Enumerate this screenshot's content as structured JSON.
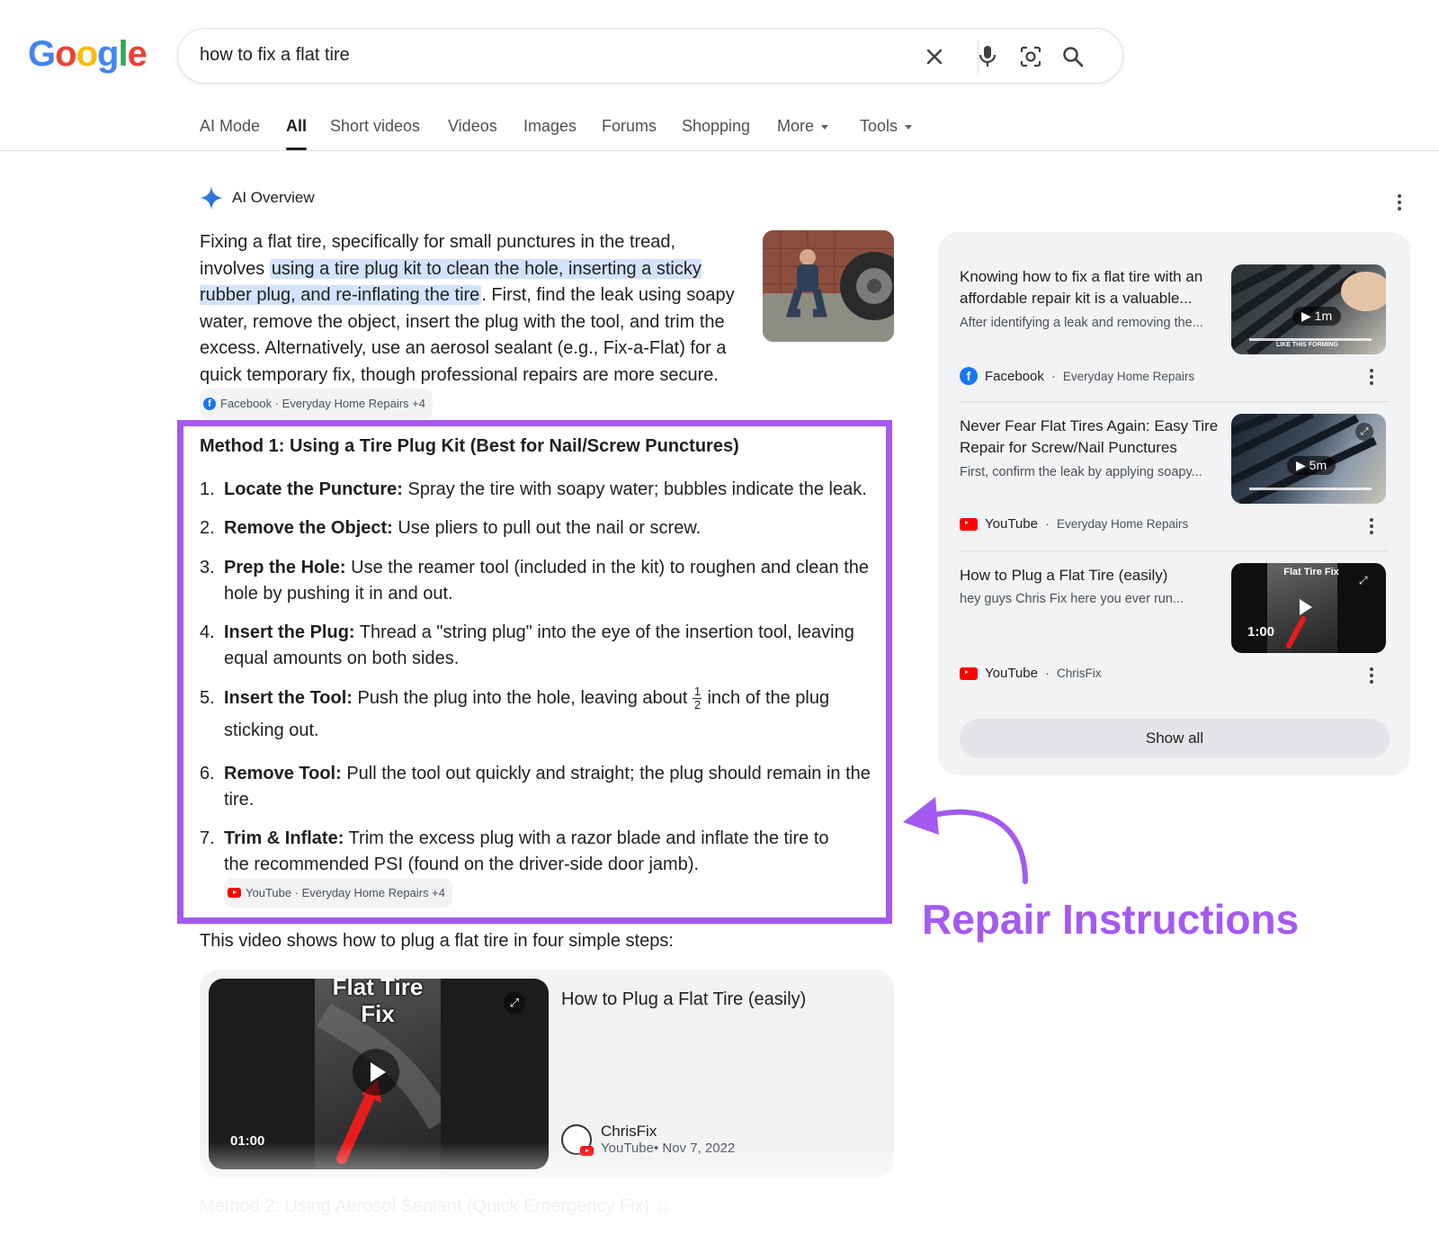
{
  "logo": "Google",
  "search": {
    "query": "how to fix a flat tire"
  },
  "tabs": [
    {
      "label": "AI Mode"
    },
    {
      "label": "All"
    },
    {
      "label": "Short videos"
    },
    {
      "label": "Videos"
    },
    {
      "label": "Images"
    },
    {
      "label": "Forums"
    },
    {
      "label": "Shopping"
    },
    {
      "label": "More"
    },
    {
      "label": "Tools"
    }
  ],
  "ai_overview": {
    "label": "AI Overview",
    "intro_before": "Fixing a flat tire, specifically for small punctures in the tread, involves ",
    "intro_highlight": "using a tire plug kit to clean the hole, inserting a sticky rubber plug, and re-inflating the tire",
    "intro_after": ". First, find the leak using soapy water, remove the object, insert the plug with the tool, and trim the excess. Alternatively, use an aerosol sealant (e.g., Fix-a-Flat) for a quick temporary fix, though professional repairs are more secure.",
    "intro_chip": "Facebook · Everyday Home Repairs +4"
  },
  "method1": {
    "title": "Method 1: Using a Tire Plug Kit (Best for Nail/Screw Punctures)",
    "steps": [
      {
        "num": "1.",
        "head": "Locate the Puncture:",
        "text": " Spray the tire with soapy water; bubbles indicate the leak."
      },
      {
        "num": "2.",
        "head": "Remove the Object:",
        "text": " Use pliers to pull out the nail or screw."
      },
      {
        "num": "3.",
        "head": "Prep the Hole:",
        "text": " Use the reamer tool (included in the kit) to roughen and clean the hole by pushing it in and out."
      },
      {
        "num": "4.",
        "head": "Insert the Plug:",
        "text": " Thread a \"string plug\" into the eye of the insertion tool, leaving equal amounts on both sides."
      },
      {
        "num": "5.",
        "head": "Insert the Tool:",
        "text": " Push the plug into the hole, leaving about",
        "frac_num": "1",
        "frac_den": "2",
        "text2": "inch of the plug sticking out."
      },
      {
        "num": "6.",
        "head": "Remove Tool:",
        "text": " Pull the tool out quickly and straight; the plug should remain in the tire."
      },
      {
        "num": "7.",
        "head": "Trim & Inflate:",
        "text": " Trim the excess plug with a razor blade and inflate the tire to the recommended PSI (found on the driver-side door jamb).",
        "chip": "YouTube · Everyday Home Repairs +4"
      }
    ]
  },
  "video_section": {
    "intro": "This video shows how to plug a flat tire in four simple steps:",
    "thumb_text_1": "Flat Tire",
    "thumb_text_2": "Fix",
    "duration": "01:00",
    "title": "How to Plug a Flat Tire (easily)",
    "channel": "ChrisFix",
    "meta": "YouTube• Nov 7, 2022"
  },
  "method2": {
    "title": "Method 2: Using Aerosol Sealant (Quick Emergency Fix)"
  },
  "sidebar": {
    "items": [
      {
        "title": "Knowing how to fix a flat tire with an affordable repair kit is a valuable...",
        "snippet": "After identifying a leak and removing the...",
        "duration": "1m",
        "thumb_caption": "LIKE THIS FORMING",
        "source": "Facebook",
        "publisher": "Everyday Home Repairs"
      },
      {
        "title": "Never Fear Flat Tires Again: Easy Tire Repair for Screw/Nail Punctures",
        "snippet": "First, confirm the leak by applying soapy...",
        "duration": "5m",
        "source": "YouTube",
        "publisher": "Everyday Home Repairs"
      },
      {
        "title": "How to Plug a Flat Tire (easily)",
        "snippet": "hey guys Chris Fix here you ever run...",
        "duration": "1:00",
        "thumb_caption": "Flat Tire Fix",
        "source": "YouTube",
        "publisher": "ChrisFix"
      }
    ],
    "show_all": "Show all"
  },
  "annotation": {
    "label": "Repair Instructions",
    "color": "#a45af0"
  }
}
